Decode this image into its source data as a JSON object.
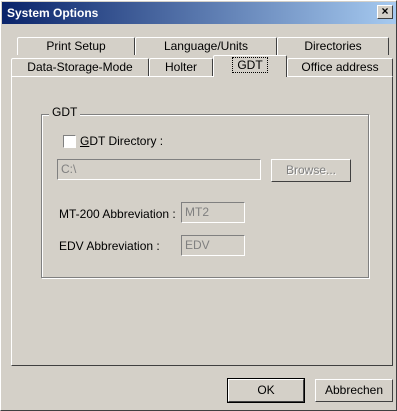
{
  "window": {
    "title": "System Options",
    "close_glyph": "×"
  },
  "tabs": {
    "row1": [
      "Print Setup",
      "Language/Units",
      "Directories"
    ],
    "row2": [
      "Data-Storage-Mode",
      "Holter",
      "GDT",
      "Office address"
    ],
    "active": "GDT"
  },
  "group": {
    "label": "GDT",
    "checkbox_accel": "G",
    "checkbox_rest": "DT Directory :",
    "directory_value": "C:\\",
    "browse_label": "Browse...",
    "mt200_label": "MT-200 Abbreviation :",
    "mt200_value": "MT2",
    "edv_label": "EDV Abbreviation :",
    "edv_value": "EDV"
  },
  "footer": {
    "ok_label": "OK",
    "cancel_label": "Abbrechen"
  }
}
